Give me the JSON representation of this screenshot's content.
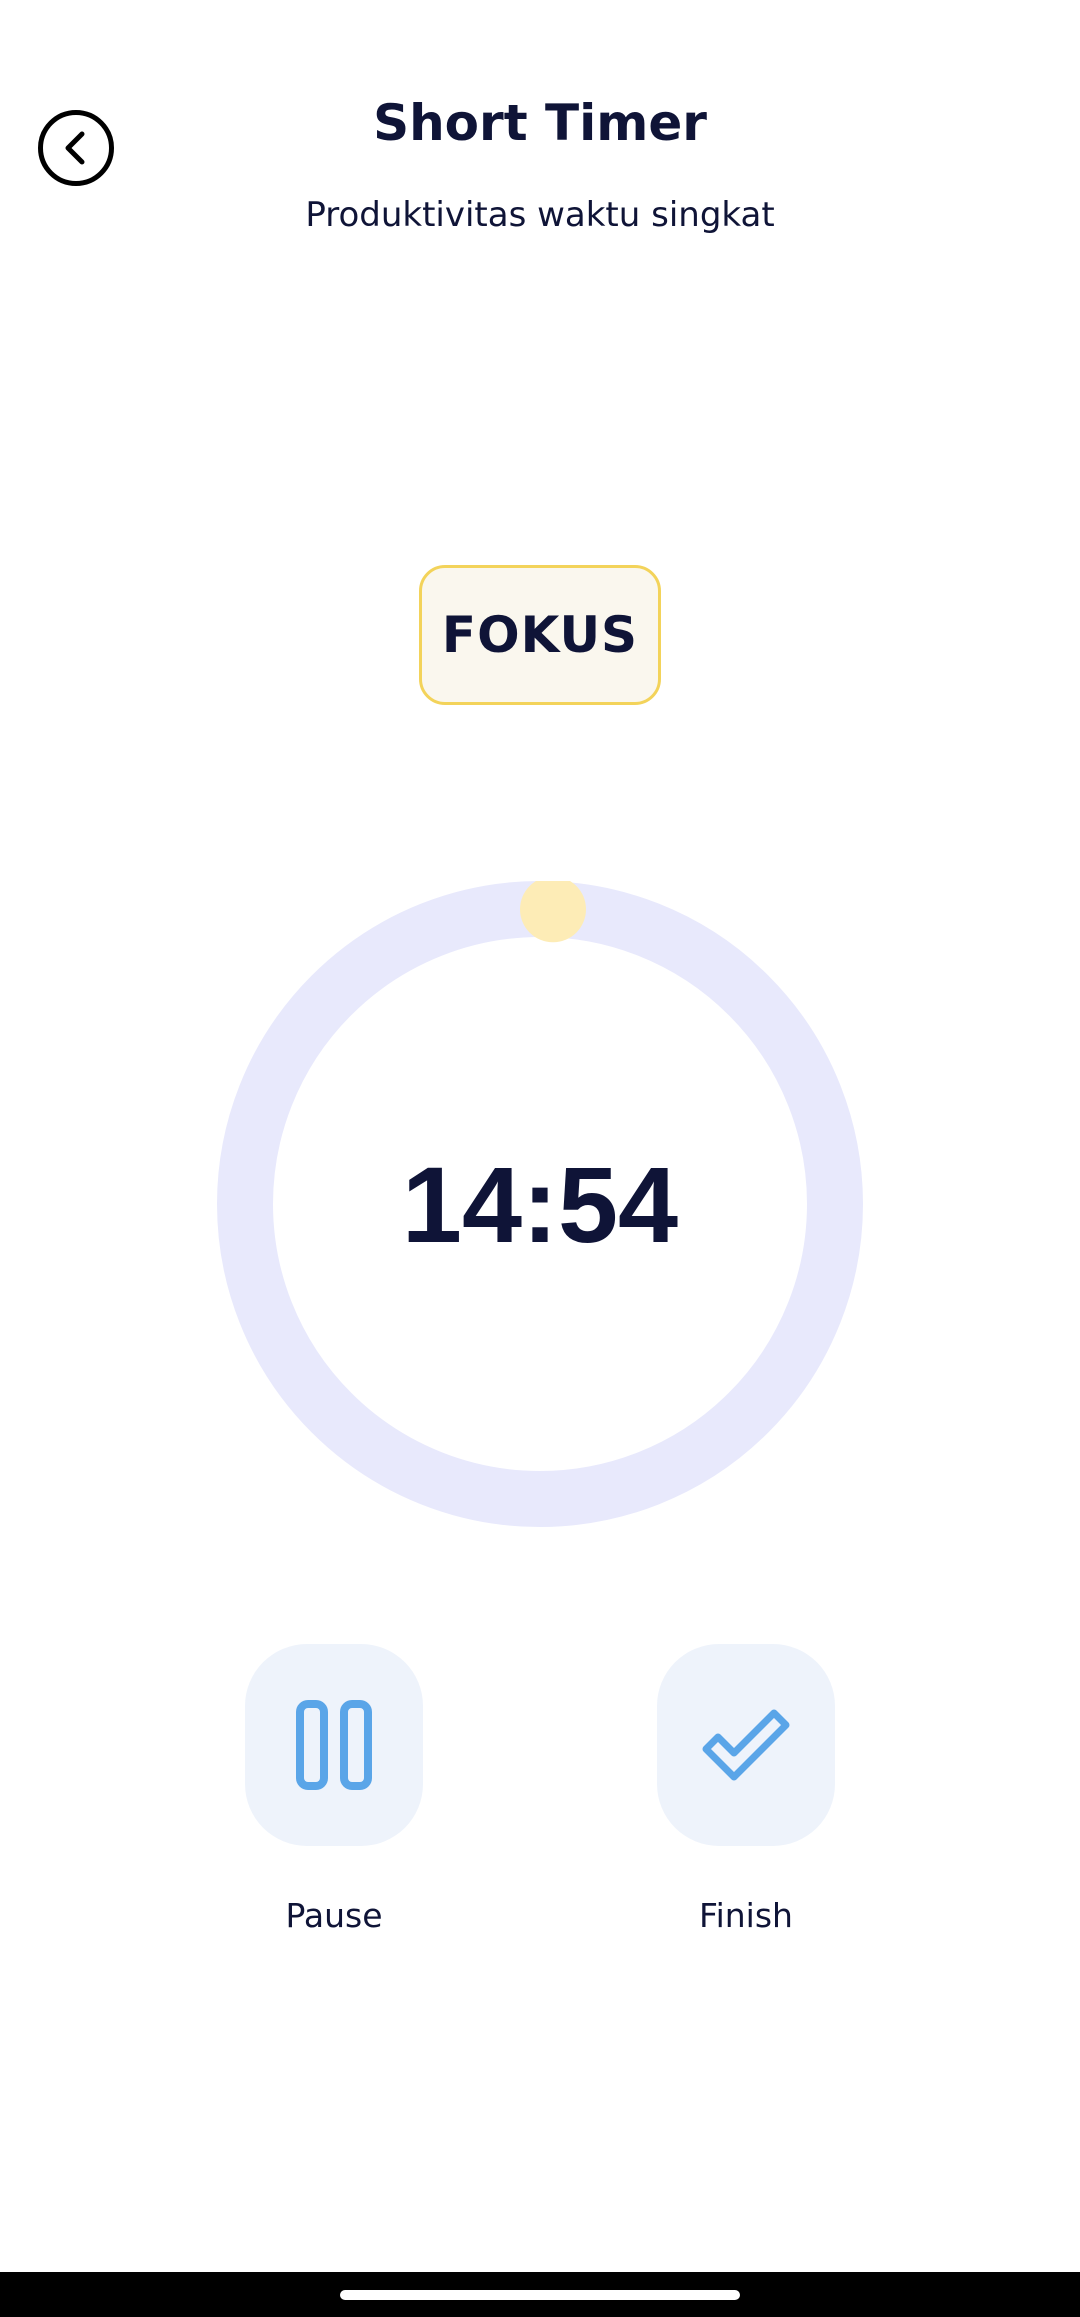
{
  "header": {
    "title": "Short Timer",
    "subtitle": "Produktivitas waktu singkat"
  },
  "mode": {
    "label": "FOKUS"
  },
  "timer": {
    "time": "14:54",
    "ring_color": "#e8e9fc",
    "progress_color": "#fdecb6",
    "progress_fraction": 0.007
  },
  "actions": {
    "pause_label": "Pause",
    "finish_label": "Finish"
  },
  "icons": {
    "back": "chevron-left-icon",
    "pause": "pause-icon",
    "finish": "check-icon"
  },
  "colors": {
    "text": "#0f1437",
    "accent_blue": "#5aa5e8",
    "badge_border": "#f3d35a",
    "badge_bg": "#faf7ee",
    "button_bg": "#eef3fb"
  }
}
